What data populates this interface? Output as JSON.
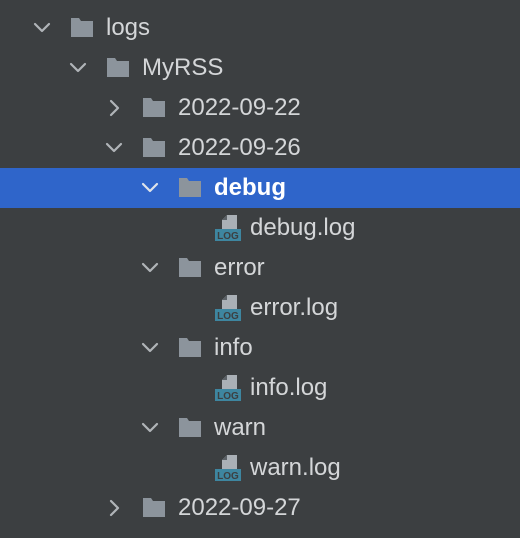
{
  "tree": {
    "items": [
      {
        "label": "logs",
        "type": "folder",
        "expanded": true,
        "icon": "folder-icon"
      },
      {
        "label": "MyRSS",
        "type": "folder",
        "expanded": true,
        "icon": "folder-icon"
      },
      {
        "label": "2022-09-22",
        "type": "folder",
        "expanded": false,
        "icon": "folder-icon"
      },
      {
        "label": "2022-09-26",
        "type": "folder",
        "expanded": true,
        "icon": "folder-icon"
      },
      {
        "label": "debug",
        "type": "folder",
        "expanded": true,
        "selected": true,
        "icon": "folder-icon"
      },
      {
        "label": "debug.log",
        "type": "file",
        "icon": "log-file-icon"
      },
      {
        "label": "error",
        "type": "folder",
        "expanded": true,
        "icon": "folder-icon"
      },
      {
        "label": "error.log",
        "type": "file",
        "icon": "log-file-icon"
      },
      {
        "label": "info",
        "type": "folder",
        "expanded": true,
        "icon": "folder-icon"
      },
      {
        "label": "info.log",
        "type": "file",
        "icon": "log-file-icon"
      },
      {
        "label": "warn",
        "type": "folder",
        "expanded": true,
        "icon": "folder-icon"
      },
      {
        "label": "warn.log",
        "type": "file",
        "icon": "log-file-icon"
      },
      {
        "label": "2022-09-27",
        "type": "folder",
        "expanded": false,
        "icon": "folder-icon"
      }
    ]
  },
  "colors": {
    "background": "#3c3f41",
    "selection": "#2f65ca",
    "text": "#d4d6d8",
    "folder": "#8c949c",
    "log_badge": "#3e86a0"
  }
}
